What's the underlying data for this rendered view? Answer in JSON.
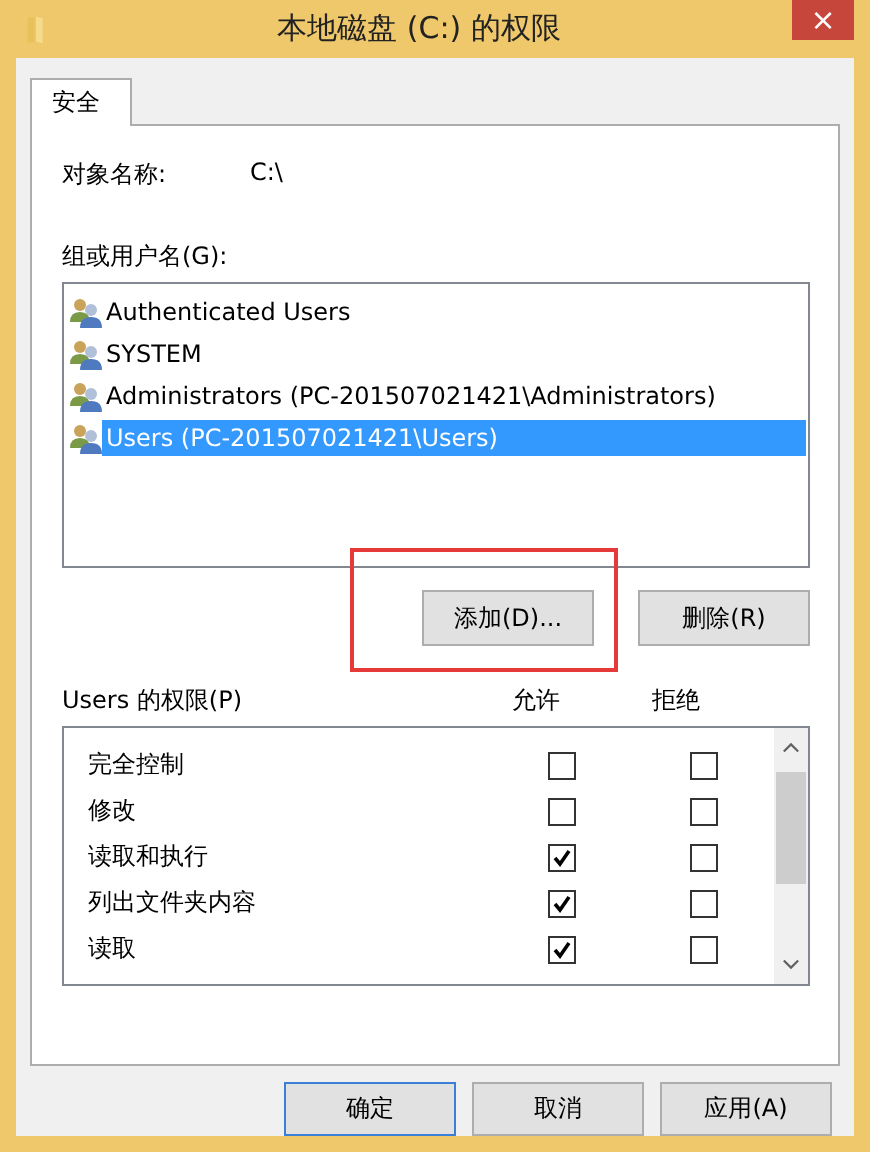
{
  "window": {
    "title": "本地磁盘 (C:) 的权限",
    "close": "×"
  },
  "tabs": [
    {
      "label": "安全",
      "selected": true
    }
  ],
  "object": {
    "label": "对象名称:",
    "value": "C:\\"
  },
  "groups": {
    "label": "组或用户名(G):",
    "items": [
      {
        "name": "Authenticated Users",
        "selected": false
      },
      {
        "name": "SYSTEM",
        "selected": false
      },
      {
        "name": "Administrators (PC-201507021421\\Administrators)",
        "selected": false
      },
      {
        "name": "Users (PC-201507021421\\Users)",
        "selected": true
      }
    ]
  },
  "group_buttons": [
    {
      "label": "添加(D)..."
    },
    {
      "label": "删除(R)"
    }
  ],
  "highlight_frame": {
    "shown": true
  },
  "permissions": {
    "label": "Users 的权限(P)",
    "allow_header": "允许",
    "deny_header": "拒绝",
    "rows": [
      {
        "name": "完全控制",
        "allow": false,
        "deny": false
      },
      {
        "name": "修改",
        "allow": false,
        "deny": false
      },
      {
        "name": "读取和执行",
        "allow": true,
        "deny": false
      },
      {
        "name": "列出文件夹内容",
        "allow": true,
        "deny": false
      },
      {
        "name": "读取",
        "allow": true,
        "deny": false
      }
    ]
  },
  "buttons": [
    {
      "label": "确定",
      "default": true
    },
    {
      "label": "取消",
      "default": false
    },
    {
      "label": "应用(A)",
      "default": false
    }
  ]
}
